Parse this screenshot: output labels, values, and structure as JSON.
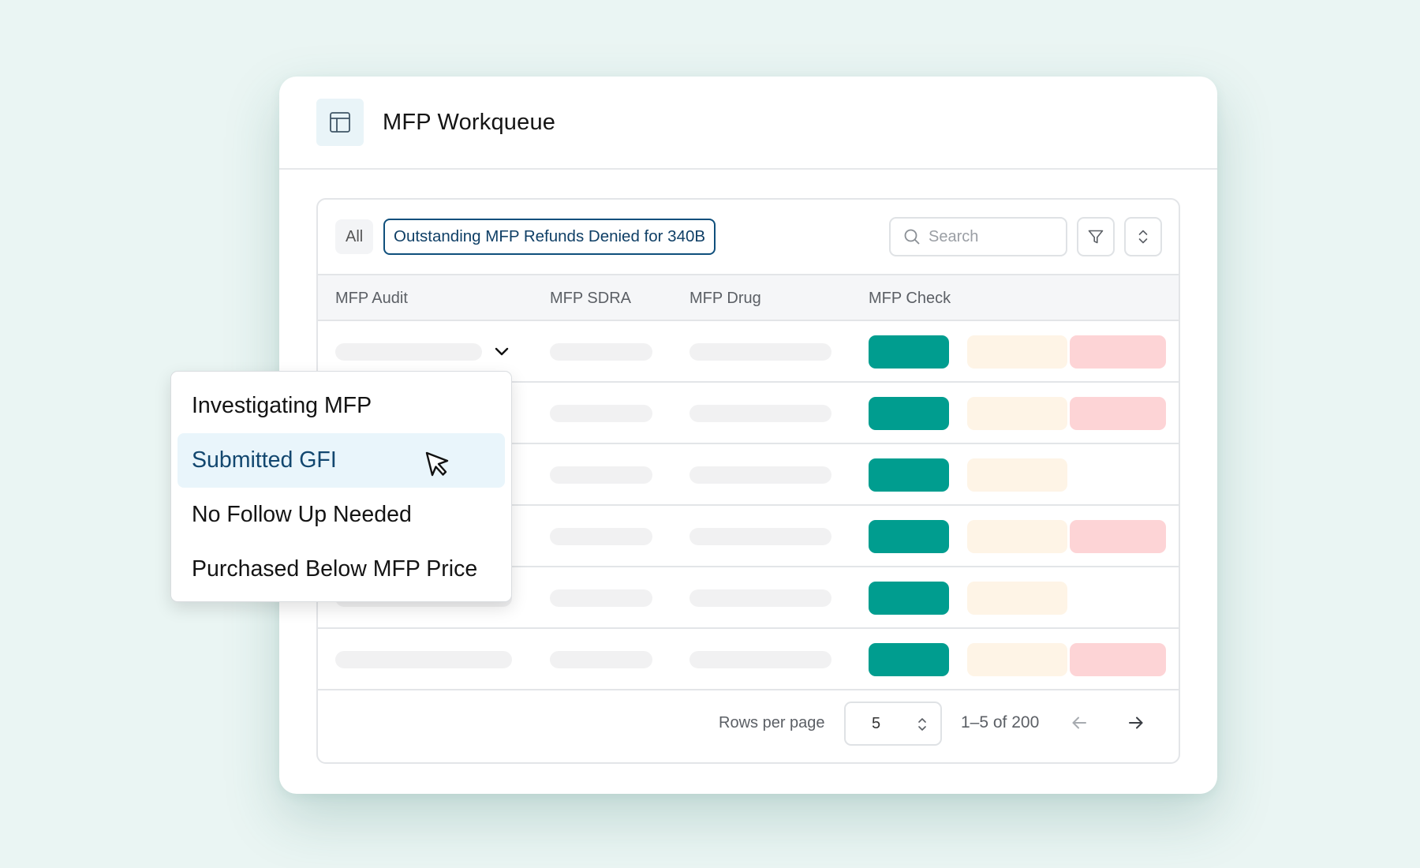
{
  "app": {
    "title": "MFP Workqueue",
    "header_icon": "table-icon"
  },
  "toolbar": {
    "chip_all": "All",
    "chip_filter": "Outstanding MFP Refunds Denied for 340B",
    "search_placeholder": "Search",
    "search_icon": "search-icon",
    "filter_icon": "filter-icon",
    "sort_icon": "sort-icon"
  },
  "table": {
    "columns": [
      "MFP Audit",
      "MFP SDRA",
      "MFP Drug",
      "MFP Check"
    ],
    "rows": [
      {
        "check_pills": [
          "green",
          "cream",
          "pink"
        ],
        "expanded": true
      },
      {
        "check_pills": [
          "green",
          "cream",
          "pink"
        ]
      },
      {
        "check_pills": [
          "green",
          "cream"
        ]
      },
      {
        "check_pills": [
          "green",
          "cream",
          "pink"
        ]
      },
      {
        "check_pills": [
          "green",
          "cream"
        ]
      },
      {
        "check_pills": [
          "green",
          "cream",
          "pink"
        ]
      }
    ]
  },
  "pagination": {
    "rows_per_page_label": "Rows per page",
    "rows_per_page_value": "5",
    "range_text": "1–5 of 200",
    "prev_icon": "arrow-left-icon",
    "next_icon": "arrow-right-icon"
  },
  "dropdown": {
    "items": [
      {
        "label": "Investigating MFP"
      },
      {
        "label": "Submitted GFI",
        "active": true
      },
      {
        "label": "No Follow Up Needed"
      },
      {
        "label": "Purchased Below MFP Price"
      }
    ]
  },
  "colors": {
    "background": "#eaf5f3",
    "accent_green": "#009d8f",
    "cream": "#fef4e6",
    "pink": "#fdd4d6",
    "filter_chip_border": "#0f4f7c",
    "active_menu_bg": "#e9f5fb"
  }
}
